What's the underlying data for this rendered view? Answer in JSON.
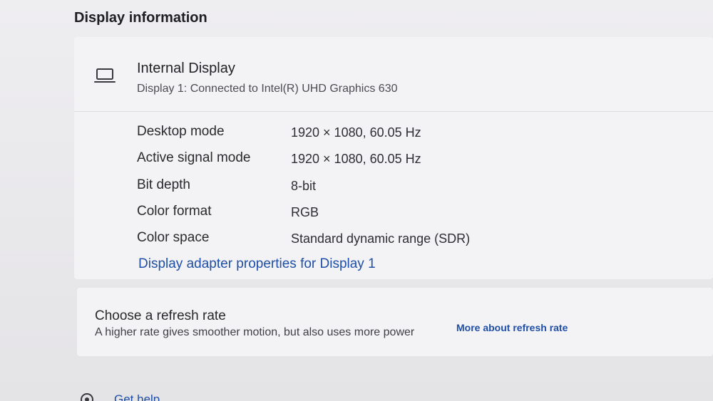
{
  "section": {
    "title": "Display information"
  },
  "display": {
    "icon": "laptop-icon",
    "name": "Internal Display",
    "subtitle": "Display 1: Connected to Intel(R) UHD Graphics 630",
    "rows": [
      {
        "label": "Desktop mode",
        "value": "1920 × 1080, 60.05 Hz"
      },
      {
        "label": "Active signal mode",
        "value": "1920 × 1080, 60.05 Hz"
      },
      {
        "label": "Bit depth",
        "value": "8-bit"
      },
      {
        "label": "Color format",
        "value": "RGB"
      },
      {
        "label": "Color space",
        "value": "Standard dynamic range (SDR)"
      }
    ],
    "adapter_link": "Display adapter properties for Display 1"
  },
  "refresh": {
    "title": "Choose a refresh rate",
    "description": "A higher rate gives smoother motion, but also uses more power",
    "link": "More about refresh rate"
  },
  "help": {
    "icon": "help-icon",
    "label": "Get help"
  },
  "colors": {
    "link": "#1f4fa6",
    "card": "#f3f2f5",
    "background": "#e9e8ea"
  }
}
